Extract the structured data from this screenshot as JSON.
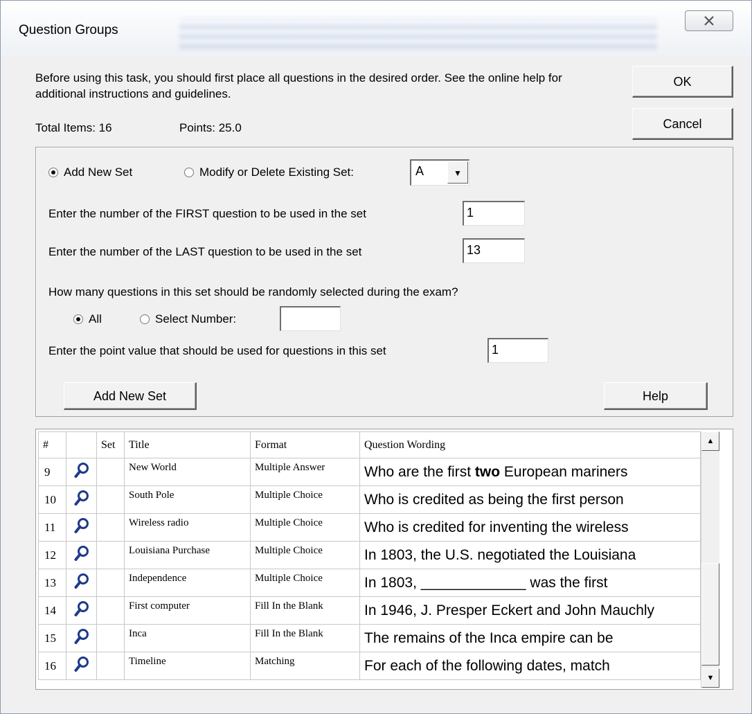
{
  "window": {
    "title": "Question Groups",
    "close_label": "X"
  },
  "info": {
    "text": "Before using this task, you should first place all questions in the desired order. See the online help for additional instructions and guidelines.",
    "total_items": "Total Items: 16",
    "points": "Points: 25.0"
  },
  "buttons": {
    "ok": "OK",
    "cancel": "Cancel",
    "add_new_set": "Add New Set",
    "help": "Help"
  },
  "set_options": {
    "add_new_label": "Add New Set",
    "modify_label": "Modify or Delete Existing Set:",
    "selected_mode": "add_new",
    "set_value": "A"
  },
  "fields": {
    "first_label": "Enter the number of the FIRST question to be used in the set",
    "first_value": "1",
    "last_label": "Enter the number of the LAST question to be used in the set",
    "last_value": "13",
    "random_label": "How many questions in this set should be randomly selected during the exam?",
    "all_label": "All",
    "select_number_label": "Select Number:",
    "select_number_value": "",
    "random_mode": "all",
    "point_label": "Enter the point value that should be used for questions in this set",
    "point_value": "1"
  },
  "table": {
    "headers": {
      "num": "#",
      "icon": "",
      "set": "Set",
      "title": "Title",
      "format": "Format",
      "wording": "Question Wording"
    },
    "rows": [
      {
        "num": "9",
        "set": "",
        "title": "New World",
        "format": "Multiple Answer",
        "wording_pre": "Who are the first ",
        "wording_bold": "two",
        "wording_post": " European mariners"
      },
      {
        "num": "10",
        "set": "",
        "title": "South Pole",
        "format": "Multiple Choice",
        "wording_pre": "Who is credited as being the first person",
        "wording_bold": "",
        "wording_post": ""
      },
      {
        "num": "11",
        "set": "",
        "title": "Wireless radio",
        "format": "Multiple Choice",
        "wording_pre": "Who is credited for inventing the wireless",
        "wording_bold": "",
        "wording_post": ""
      },
      {
        "num": "12",
        "set": "",
        "title": "Louisiana Purchase",
        "format": "Multiple Choice",
        "wording_pre": "In 1803, the U.S. negotiated the Louisiana",
        "wording_bold": "",
        "wording_post": ""
      },
      {
        "num": "13",
        "set": "",
        "title": "Independence",
        "format": "Multiple Choice",
        "wording_pre": "In 1803, _____________ was the first",
        "wording_bold": "",
        "wording_post": ""
      },
      {
        "num": "14",
        "set": "",
        "title": "First computer",
        "format": "Fill In the Blank",
        "wording_pre": "In 1946, J. Presper Eckert and John Mauchly",
        "wording_bold": "",
        "wording_post": ""
      },
      {
        "num": "15",
        "set": "",
        "title": "Inca",
        "format": "Fill In the Blank",
        "wording_pre": "The remains of the Inca empire can be",
        "wording_bold": "",
        "wording_post": ""
      },
      {
        "num": "16",
        "set": "",
        "title": "Timeline",
        "format": "Matching",
        "wording_pre": "For each of the following dates, match",
        "wording_bold": "",
        "wording_post": ""
      }
    ]
  },
  "icons": {
    "row_icon": "magnifier-icon",
    "close": "close-icon",
    "dropdown": "dropdown-arrow-icon",
    "scroll_up": "scroll-up-icon",
    "scroll_down": "scroll-down-icon"
  }
}
